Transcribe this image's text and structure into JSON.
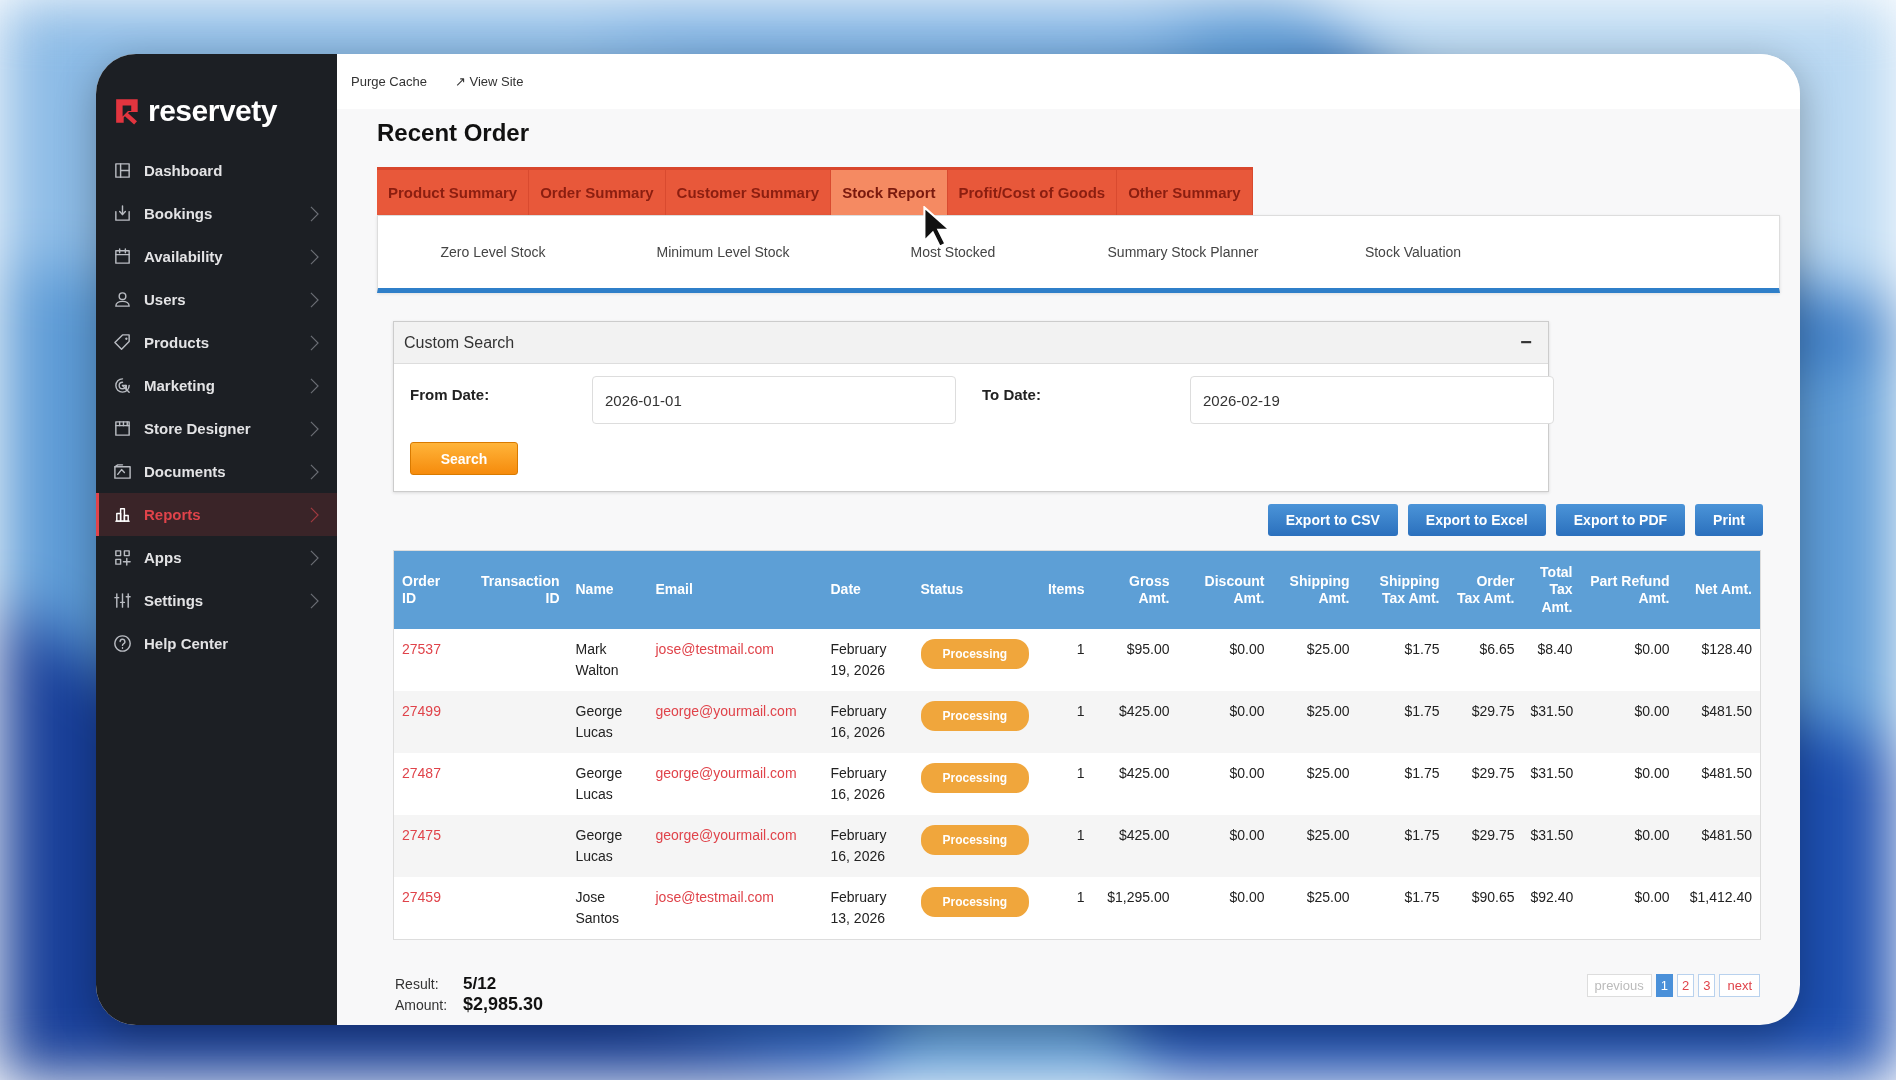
{
  "sidebar": {
    "logo": "reservety",
    "items": [
      {
        "label": "Dashboard",
        "has_submenu": false,
        "selected": false
      },
      {
        "label": "Bookings",
        "has_submenu": true,
        "selected": false
      },
      {
        "label": "Availability",
        "has_submenu": true,
        "selected": false
      },
      {
        "label": "Users",
        "has_submenu": true,
        "selected": false
      },
      {
        "label": "Products",
        "has_submenu": true,
        "selected": false
      },
      {
        "label": "Marketing",
        "has_submenu": true,
        "selected": false
      },
      {
        "label": "Store Designer",
        "has_submenu": true,
        "selected": false
      },
      {
        "label": "Documents",
        "has_submenu": true,
        "selected": false
      },
      {
        "label": "Reports",
        "has_submenu": true,
        "selected": true
      },
      {
        "label": "Apps",
        "has_submenu": true,
        "selected": false
      },
      {
        "label": "Settings",
        "has_submenu": true,
        "selected": false
      },
      {
        "label": "Help Center",
        "has_submenu": false,
        "selected": false
      }
    ]
  },
  "top_bar": {
    "links": [
      "Purge Cache",
      "↗ View Site"
    ]
  },
  "page_title": "Recent Order",
  "tabs": [
    {
      "label": "Product Summary",
      "selected": false
    },
    {
      "label": "Order Summary",
      "selected": false
    },
    {
      "label": "Customer Summary",
      "selected": false
    },
    {
      "label": "Stock Report",
      "selected": true
    },
    {
      "label": "Profit/Cost of Goods",
      "selected": false
    },
    {
      "label": "Other Summary",
      "selected": false
    }
  ],
  "sub_tabs": [
    "Zero Level Stock",
    "Minimum Level Stock",
    "Most Stocked",
    "Summary Stock Planner",
    "Stock Valuation"
  ],
  "custom_search": {
    "title": "Custom Search",
    "collapse": "−",
    "from_label": "From Date:",
    "from_value": "2026-01-01",
    "to_label": "To Date:",
    "to_value": "2026-02-19",
    "button": "Search"
  },
  "export_buttons": [
    "Export to CSV",
    "Export to Excel",
    "Export to PDF",
    "Print"
  ],
  "table": {
    "columns": [
      "Order ID",
      "Transaction ID",
      "Name",
      "Email",
      "Date",
      "Status",
      "Items",
      "Gross Amt.",
      "Discount Amt.",
      "Shipping Amt.",
      "Shipping Tax Amt.",
      "Order Tax Amt.",
      "Total Tax Amt.",
      "Part Refund Amt.",
      "Net Amt."
    ],
    "rows": [
      {
        "order_id": "27537",
        "name": "Mark Walton",
        "email": "jose@testmail.com",
        "date": "February 19, 2026",
        "status": "Processing",
        "items": "1",
        "gross": "$95.00",
        "discount": "$0.00",
        "shipping": "$25.00",
        "shipping_tax": "$1.75",
        "order_tax": "$6.65",
        "total_tax": "$8.40",
        "part_refund": "$0.00",
        "net": "$128.40"
      },
      {
        "order_id": "27499",
        "name": "George Lucas",
        "email": "george@yourmail.com",
        "date": "February 16, 2026",
        "status": "Processing",
        "items": "1",
        "gross": "$425.00",
        "discount": "$0.00",
        "shipping": "$25.00",
        "shipping_tax": "$1.75",
        "order_tax": "$29.75",
        "total_tax": "$31.50",
        "part_refund": "$0.00",
        "net": "$481.50"
      },
      {
        "order_id": "27487",
        "name": "George Lucas",
        "email": "george@yourmail.com",
        "date": "February 16, 2026",
        "status": "Processing",
        "items": "1",
        "gross": "$425.00",
        "discount": "$0.00",
        "shipping": "$25.00",
        "shipping_tax": "$1.75",
        "order_tax": "$29.75",
        "total_tax": "$31.50",
        "part_refund": "$0.00",
        "net": "$481.50"
      },
      {
        "order_id": "27475",
        "name": "George Lucas",
        "email": "george@yourmail.com",
        "date": "February 16, 2026",
        "status": "Processing",
        "items": "1",
        "gross": "$425.00",
        "discount": "$0.00",
        "shipping": "$25.00",
        "shipping_tax": "$1.75",
        "order_tax": "$29.75",
        "total_tax": "$31.50",
        "part_refund": "$0.00",
        "net": "$481.50"
      },
      {
        "order_id": "27459",
        "name": "Jose Santos",
        "email": "jose@testmail.com",
        "date": "February 13, 2026",
        "status": "Processing",
        "items": "1",
        "gross": "$1,295.00",
        "discount": "$0.00",
        "shipping": "$25.00",
        "shipping_tax": "$1.75",
        "order_tax": "$90.65",
        "total_tax": "$92.40",
        "part_refund": "$0.00",
        "net": "$1,412.40"
      }
    ]
  },
  "summary": {
    "result_label": "Result:",
    "result_value": "5/12",
    "amount_label": "Amount:",
    "amount_value": "$2,985.30"
  },
  "pagination": [
    {
      "label": "previous",
      "kind": "nav",
      "disabled": true,
      "selected": false
    },
    {
      "label": "1",
      "kind": "page",
      "disabled": false,
      "selected": true
    },
    {
      "label": "2",
      "kind": "page",
      "disabled": false,
      "selected": false
    },
    {
      "label": "3",
      "kind": "page",
      "disabled": false,
      "selected": false
    },
    {
      "label": "next",
      "kind": "nav",
      "disabled": false,
      "selected": false
    }
  ]
}
